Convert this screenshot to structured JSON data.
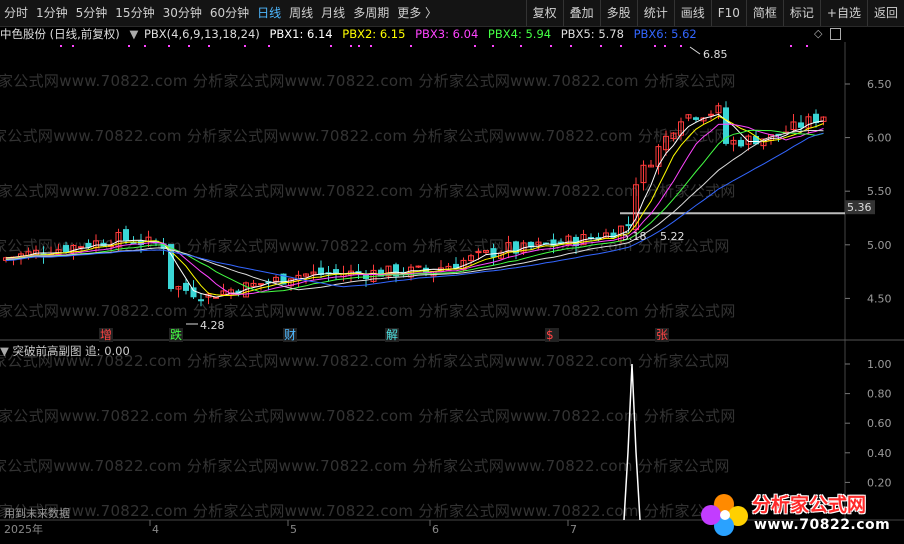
{
  "toolbar": {
    "left_items": [
      "分时",
      "1分钟",
      "5分钟",
      "15分钟",
      "30分钟",
      "60分钟",
      "日线",
      "周线",
      "月线",
      "多周期",
      "更多 〉"
    ],
    "active": "日线",
    "right_items": [
      "复权",
      "叠加",
      "多股",
      "统计",
      "画线",
      "F10",
      "简框",
      "标记",
      "+自选",
      "返回"
    ]
  },
  "main_title": {
    "stock": "中色股份 (日线,前复权)",
    "indicator": "PBX(4,6,9,13,18,24)",
    "pbx1_label": "PBX1:",
    "pbx1": "6.14",
    "pbx2_label": "PBX2:",
    "pbx2": "6.15",
    "pbx3_label": "PBX3:",
    "pbx3": "6.04",
    "pbx4_label": "PBX4:",
    "pbx4": "5.94",
    "pbx5_label": "PBX5:",
    "pbx5": "5.78",
    "pbx6_label": "PBX6:",
    "pbx6": "5.62"
  },
  "colors": {
    "pbx1": "#ffffff",
    "pbx2": "#ffff00",
    "pbx3": "#ff44ff",
    "pbx4": "#44ff44",
    "pbx5": "#dddddd",
    "pbx6": "#3366ff",
    "up": "#ff3b3b",
    "down": "#3ad6d6",
    "axis": "#9a9a9a"
  },
  "y_axis": [
    "6.50",
    "6.00",
    "5.50",
    "5.00",
    "4.50"
  ],
  "price_tag": "5.36",
  "annotations": {
    "high": "6.85",
    "low": "4.28",
    "mid1": "5.18",
    "mid2": "5.22"
  },
  "markers": [
    {
      "text": "增",
      "color": "#ff4444"
    },
    {
      "text": "跌",
      "color": "#44ff44"
    },
    {
      "text": "财",
      "color": "#4fb8ff"
    },
    {
      "text": "解",
      "color": "#4fe0e0"
    },
    {
      "text": "$",
      "color": "#ff4444"
    },
    {
      "text": "张",
      "color": "#ff4444"
    }
  ],
  "watermark": "家公式网www.70822.com 分析家公式网www.70822.com 分析家公式网www.70822.com 分析家公式网",
  "sub_chart": {
    "title": "突破前高副图",
    "value_label": "追:",
    "value": "0.00",
    "y_axis": [
      "1.00",
      "0.80",
      "0.60",
      "0.40",
      "0.20"
    ]
  },
  "future_note": "用到未来数据",
  "x_axis": [
    "2025年",
    "4",
    "5",
    "6",
    "7"
  ],
  "logo": {
    "name": "分析家公式网",
    "url": "www.70822.com"
  }
}
